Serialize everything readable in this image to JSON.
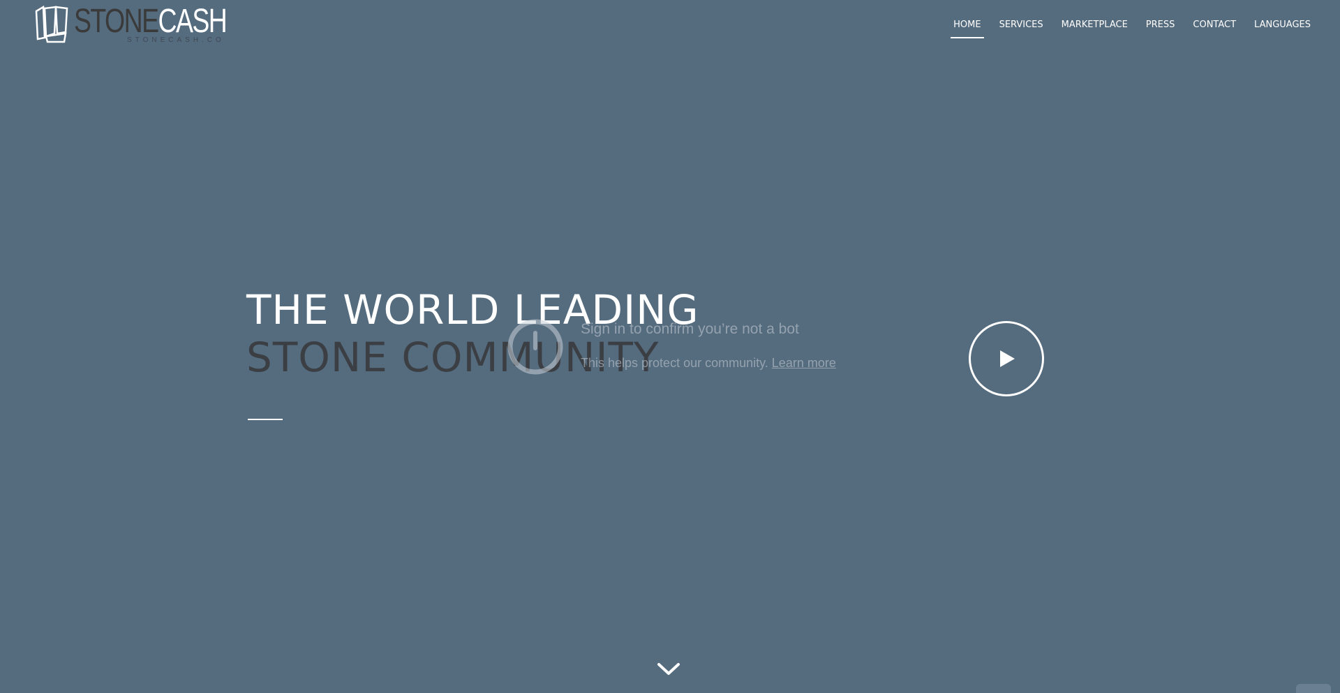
{
  "header": {
    "logo": {
      "word_part1": "STONE",
      "word_part2": "CASH",
      "subtitle": "STONECASH.CO",
      "icon": "stone-blocks-icon"
    },
    "nav": [
      {
        "label": "HOME",
        "active": true
      },
      {
        "label": "SERVICES",
        "active": false
      },
      {
        "label": "MARKETPLACE",
        "active": false
      },
      {
        "label": "PRESS",
        "active": false
      },
      {
        "label": "CONTACT",
        "active": false
      },
      {
        "label": "LANGUAGES",
        "active": false
      }
    ]
  },
  "hero": {
    "line1": "THE WORLD LEADING",
    "line2": "STONE COMMUNITY"
  },
  "bot_overlay": {
    "title": "Sign in to confirm you’re not a bot",
    "text": "This helps protect our community.",
    "link": "Learn more",
    "icon": "warning-power-icon"
  },
  "play_button": {
    "icon": "play-icon"
  },
  "scroll_down": {
    "icon": "chevron-down-icon"
  },
  "colors": {
    "background": "#556b7e",
    "text_primary": "#ffffff",
    "text_dark": "#3b3f44"
  }
}
